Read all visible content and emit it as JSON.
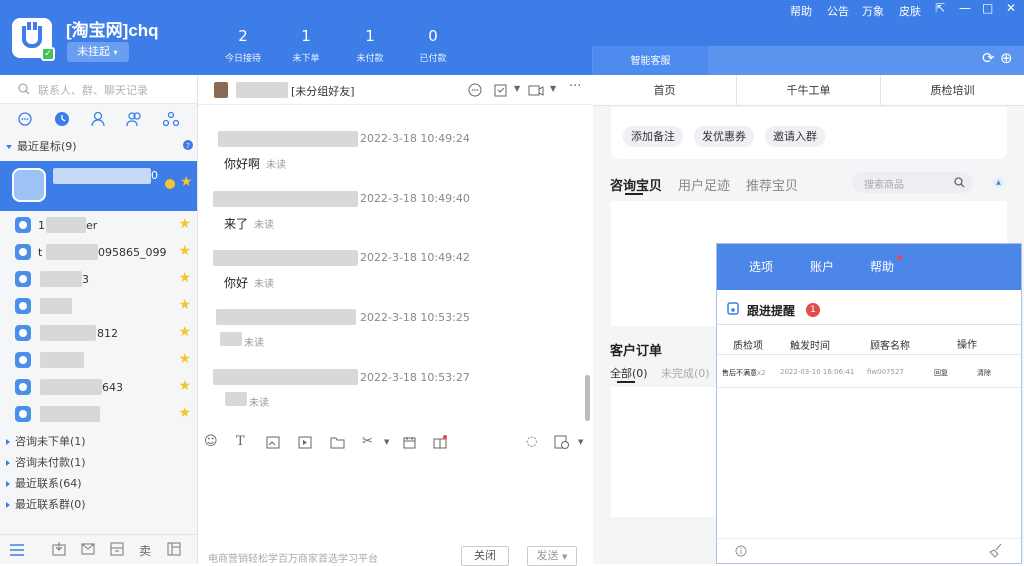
{
  "app": {
    "shop_name": "[淘宝网]chq",
    "status_label": "未挂起",
    "status_caret": "▾",
    "menu": [
      "帮助",
      "公告",
      "万象",
      "皮肤"
    ],
    "window_controls": [
      "⇱",
      "—",
      "□",
      "✕"
    ],
    "stats": [
      {
        "value": "2",
        "label": "今日接待"
      },
      {
        "value": "1",
        "label": "未下单"
      },
      {
        "value": "1",
        "label": "未付款"
      },
      {
        "value": "0",
        "label": "已付款"
      }
    ],
    "smart_tab": "智能客服",
    "refresh_icon": "⟳",
    "add_icon": "⊕"
  },
  "sidebar": {
    "search_placeholder": "联系人、群、聊天记录",
    "group_starred": "最近星标(9)",
    "selected_suffix": "0",
    "contacts_suffix": [
      "er",
      "095865_099",
      "3",
      "",
      "812",
      "",
      "643",
      ""
    ],
    "contact_prefix": [
      "1",
      "t",
      "",
      "",
      "",
      "",
      "",
      ""
    ],
    "groups": [
      "咨询未下单(1)",
      "咨询未付款(1)",
      "最近联系(64)",
      "最近联系群(0)"
    ]
  },
  "chat": {
    "header_tag": "[未分组好友]",
    "messages": [
      {
        "time": "2022-3-18 10:49:24",
        "text": "你好啊",
        "status": "未读"
      },
      {
        "time": "2022-3-18 10:49:40",
        "text": "来了",
        "status": "未读"
      },
      {
        "time": "2022-3-18 10:49:42",
        "text": "你好",
        "status": "未读"
      },
      {
        "time": "2022-3-18 10:53:25",
        "text": "",
        "status": "未读"
      },
      {
        "time": "2022-3-18 10:53:27",
        "text": "",
        "status": "未读"
      }
    ],
    "footer_text": "电商营销轻松学百万商家首选学习平台",
    "close_button": "关闭",
    "send_button": "发送"
  },
  "right": {
    "tabs": [
      "首页",
      "千牛工单",
      "质检培训"
    ],
    "actions": [
      "添加备注",
      "发优惠券",
      "邀请入群"
    ],
    "product_tabs": [
      "咨询宝贝",
      "用户足迹",
      "推荐宝贝"
    ],
    "product_search_placeholder": "搜索商品",
    "order_title": "客户订单",
    "order_tabs": [
      "全部(0)",
      "未完成(0)"
    ]
  },
  "popup": {
    "menu": [
      "选项",
      "账户",
      "帮助"
    ],
    "title": "跟进提醒",
    "badge": "1",
    "columns": [
      "质检项",
      "触发时间",
      "顾客名称",
      "操作"
    ],
    "row": {
      "item": "售后不满意",
      "count": "x2",
      "time": "2022-03-10 16:06:41",
      "customer": "fiw007527",
      "action1": "回复",
      "action2": "清除"
    }
  },
  "colors": {
    "accent": "#3c7de8",
    "star": "#f2c531",
    "badge": "#e24c4c",
    "online": "#44c35a"
  }
}
